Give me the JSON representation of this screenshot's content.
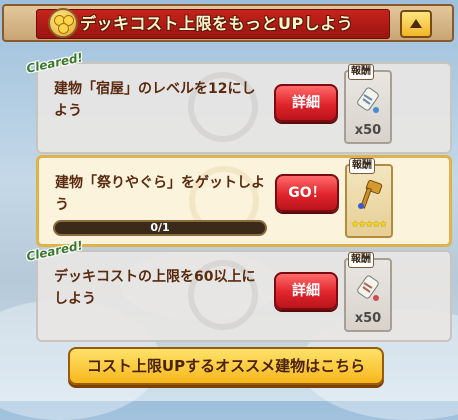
{
  "header": {
    "title": "デッキコスト上限をもっとUPしよう"
  },
  "missions": [
    {
      "status_stamp": "Cleared!",
      "text": "建物「宿屋」のレベルを12にしよう",
      "button_label": "詳細",
      "reward_label": "報酬",
      "reward_icon": "scroll-icon",
      "reward_count": "x50"
    },
    {
      "text": "建物「祭りやぐら」をゲットしよう",
      "button_label": "GO！",
      "reward_label": "報酬",
      "reward_icon": "hammer-icon",
      "reward_stars": "★★★★★",
      "progress_text": "0/1",
      "progress_fraction": 0
    },
    {
      "status_stamp": "Cleared!",
      "text": "デッキコストの上限を60以上にしよう",
      "button_label": "詳細",
      "reward_label": "報酬",
      "reward_icon": "scroll-icon",
      "reward_count": "x50"
    }
  ],
  "bottom_button": {
    "label": "コスト上限UPするオススメ建物はこちら"
  },
  "colors": {
    "accent_red": "#e0242c",
    "banner_red": "#c7231b",
    "gold": "#f6b71c"
  }
}
